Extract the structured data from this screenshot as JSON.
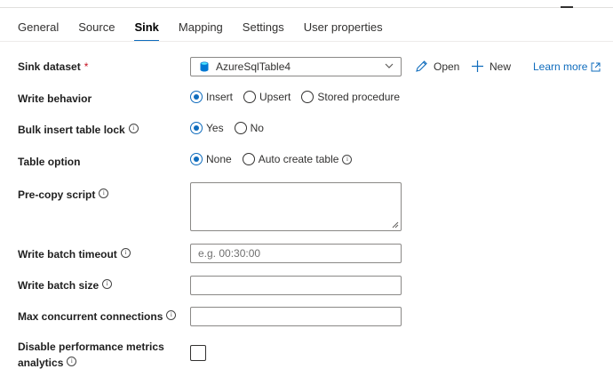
{
  "tabs": [
    {
      "label": "General",
      "active": false
    },
    {
      "label": "Source",
      "active": false
    },
    {
      "label": "Sink",
      "active": true
    },
    {
      "label": "Mapping",
      "active": false
    },
    {
      "label": "Settings",
      "active": false
    },
    {
      "label": "User properties",
      "active": false
    }
  ],
  "sink_dataset": {
    "label": "Sink dataset",
    "required_marker": "*",
    "value": "AzureSqlTable4",
    "open_label": "Open",
    "new_label": "New",
    "learn_more_label": "Learn more"
  },
  "write_behavior": {
    "label": "Write behavior",
    "options": [
      "Insert",
      "Upsert",
      "Stored procedure"
    ],
    "selected": "Insert"
  },
  "bulk_insert": {
    "label": "Bulk insert table lock",
    "info_icon": "info-icon",
    "options": [
      "Yes",
      "No"
    ],
    "selected": "Yes"
  },
  "table_option": {
    "label": "Table option",
    "options": [
      "None",
      "Auto create table"
    ],
    "selected": "None",
    "info_icon": "info-icon"
  },
  "pre_copy_script": {
    "label": "Pre-copy script",
    "value": ""
  },
  "write_batch_timeout": {
    "label": "Write batch timeout",
    "value": "",
    "placeholder": "e.g. 00:30:00"
  },
  "write_batch_size": {
    "label": "Write batch size",
    "value": ""
  },
  "max_concurrent": {
    "label": "Max concurrent connections",
    "value": ""
  },
  "disable_metrics": {
    "label_line1": "Disable performance metrics",
    "label_line2": "analytics",
    "checked": false
  },
  "colors": {
    "accent": "#0f6cbd",
    "required": "#c50f1f",
    "border": "#8a8886"
  }
}
